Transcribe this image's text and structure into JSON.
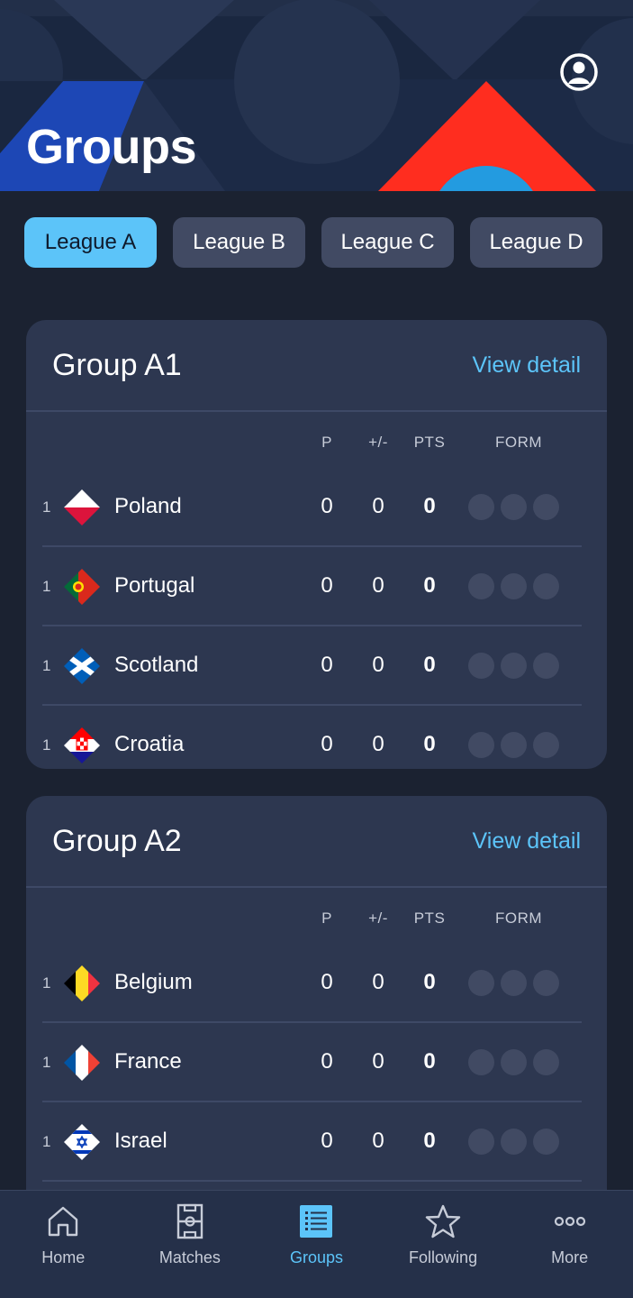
{
  "header": {
    "title": "Groups"
  },
  "tabs": [
    {
      "label": "League A",
      "active": true
    },
    {
      "label": "League B",
      "active": false
    },
    {
      "label": "League C",
      "active": false
    },
    {
      "label": "League D",
      "active": false
    }
  ],
  "columns": {
    "p": "P",
    "diff": "+/-",
    "pts": "PTS",
    "form": "FORM"
  },
  "groups": [
    {
      "title": "Group A1",
      "action": "View detail",
      "teams": [
        {
          "rank": "1",
          "name": "Poland",
          "p": "0",
          "diff": "0",
          "pts": "0",
          "flag": "poland-flag-icon"
        },
        {
          "rank": "1",
          "name": "Portugal",
          "p": "0",
          "diff": "0",
          "pts": "0",
          "flag": "portugal-flag-icon"
        },
        {
          "rank": "1",
          "name": "Scotland",
          "p": "0",
          "diff": "0",
          "pts": "0",
          "flag": "scotland-flag-icon"
        },
        {
          "rank": "1",
          "name": "Croatia",
          "p": "0",
          "diff": "0",
          "pts": "0",
          "flag": "croatia-flag-icon"
        }
      ]
    },
    {
      "title": "Group A2",
      "action": "View detail",
      "teams": [
        {
          "rank": "1",
          "name": "Belgium",
          "p": "0",
          "diff": "0",
          "pts": "0",
          "flag": "belgium-flag-icon"
        },
        {
          "rank": "1",
          "name": "France",
          "p": "0",
          "diff": "0",
          "pts": "0",
          "flag": "france-flag-icon"
        },
        {
          "rank": "1",
          "name": "Israel",
          "p": "0",
          "diff": "0",
          "pts": "0",
          "flag": "israel-flag-icon"
        }
      ]
    }
  ],
  "nav": [
    {
      "label": "Home",
      "icon": "home-icon",
      "active": false
    },
    {
      "label": "Matches",
      "icon": "pitch-icon",
      "active": false
    },
    {
      "label": "Groups",
      "icon": "list-icon",
      "active": true
    },
    {
      "label": "Following",
      "icon": "star-icon",
      "active": false
    },
    {
      "label": "More",
      "icon": "more-icon",
      "active": false
    }
  ],
  "colors": {
    "accent": "#5cc4f9",
    "background": "#1b2231",
    "card": "#2d3750",
    "tab": "#414a63"
  }
}
